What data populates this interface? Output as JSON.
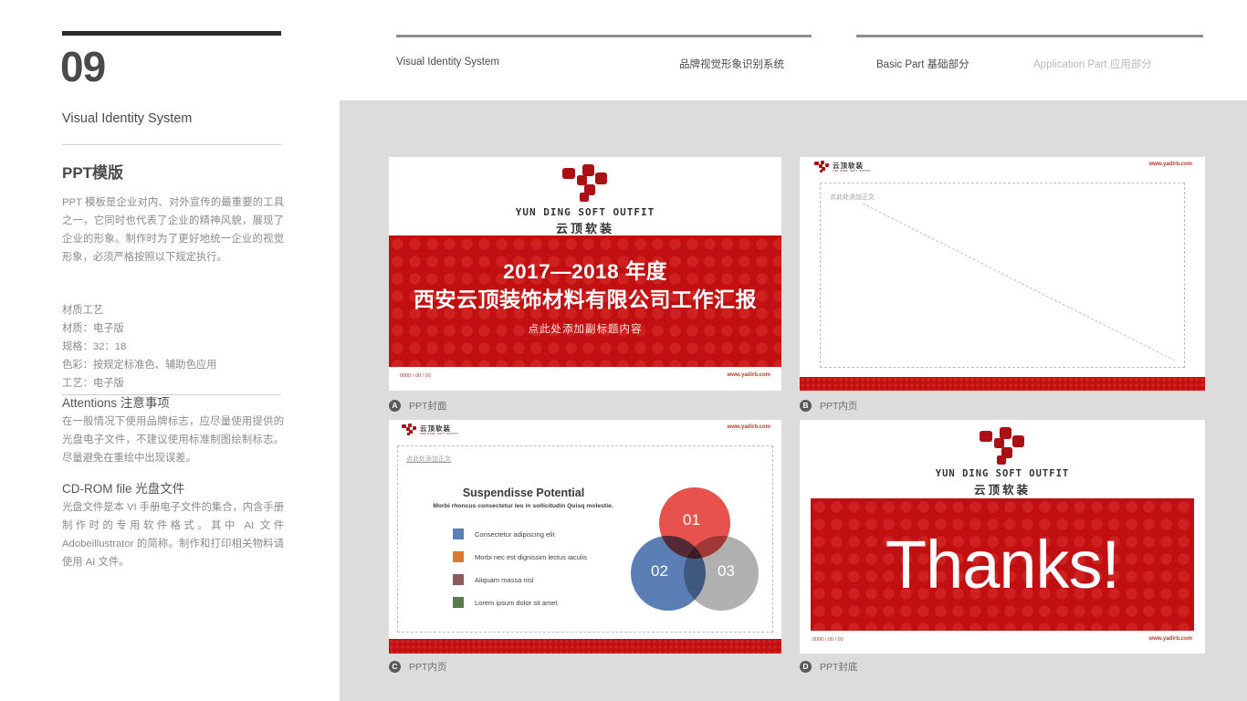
{
  "sidebar": {
    "number": "09",
    "subtitle": "Visual Identity System",
    "section_title": "PPT模版",
    "body_paragraph": "PPT 模板是企业对内、对外宣传的最重要的工具之一，它同时也代表了企业的精神风貌，展现了企业的形象。制作时为了更好地统一企业的视觉形象，必须严格按照以下规定执行。",
    "spec_lines": [
      "材质工艺",
      "材质：电子版",
      "规格：32：18",
      "色彩：按规定标准色、辅助色应用",
      "工艺：电子版"
    ],
    "attentions_title": "Attentions 注意事项",
    "attentions_body": "在一般情况下使用品牌标志，应尽量使用提供的光盘电子文件，不建议使用标准制图绘制标志。尽量避免在重绘中出现误差。",
    "cdrom_title": "CD-ROM file 光盘文件",
    "cdrom_body": "光盘文件是本 VI 手册电子文件的集合，内含手册制作时的专用软件格式。其中 AI 文件 Adobeillustrator 的简称。制作和打印相关物料请使用 AI 文件。"
  },
  "topnav": {
    "left_en": "Visual Identity System",
    "left_cn": "品牌视觉形象识别系统",
    "right_active": "Basic Part 基础部分",
    "right_inactive": "Application Part 应用部分"
  },
  "brand": {
    "logo_en": "YUN DING SOFT OUTFIT",
    "logo_cn": "云顶软装",
    "url": "www.yadirb.com",
    "date_stamp": "0000 / 00 / 00",
    "red": "#c10f12",
    "logo_red": "#aa1014"
  },
  "slides": [
    {
      "badge": "A",
      "caption": "PPT封面",
      "title_line1": "2017—2018 年度",
      "title_line2": "西安云顶装饰材料有限公司工作汇报",
      "subtitle": "点此处添加副标题内容"
    },
    {
      "badge": "B",
      "caption": "PPT内页",
      "placeholder": "点此处添加正文"
    },
    {
      "badge": "C",
      "caption": "PPT内页",
      "placeholder": "点此处添加正文",
      "headline": "Suspendisse Potential",
      "subhead": "Morbi rhoncus consectetur leo in sollicitudin Quisq molestie."
    },
    {
      "badge": "D",
      "caption": "PPT封底",
      "thanks": "Thanks!"
    }
  ],
  "chart_data": {
    "type": "pie",
    "title": "Suspendisse Potential",
    "subtitle": "Morbi rhoncus consectetur leo in sollicitudin Quisq molestie.",
    "venn_labels": [
      "01",
      "02",
      "03"
    ],
    "venn_colors": [
      "#e8524c",
      "#5b7fb5",
      "#b0b0b0"
    ],
    "legend": [
      {
        "label": "Consectetur adipiscing elit",
        "color": "#5b7fb5"
      },
      {
        "label": "Morbi nec est dignissim lectus iaculis",
        "color": "#dd7a31"
      },
      {
        "label": "Aliquam massa nisl",
        "color": "#8b5a5e"
      },
      {
        "label": "Lorem ipsum dolor sit amet",
        "color": "#5c7a4e"
      }
    ],
    "legend_position": "left"
  }
}
